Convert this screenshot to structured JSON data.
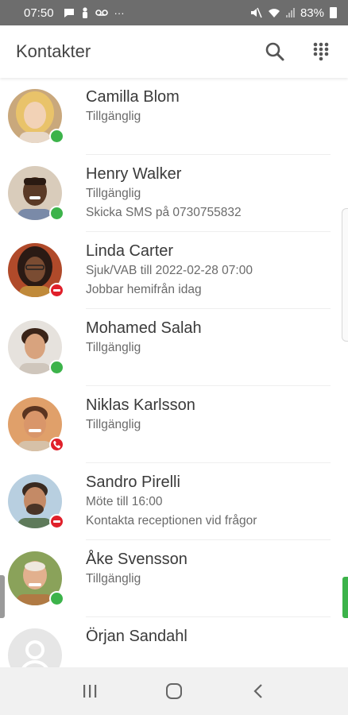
{
  "status_bar": {
    "time": "07:50",
    "battery": "83%",
    "icons": [
      "message-icon",
      "person-icon",
      "voicemail-icon",
      "more-icon",
      "mute-icon",
      "wifi-icon",
      "signal-icon",
      "battery-icon"
    ]
  },
  "app_bar": {
    "title": "Kontakter",
    "actions": [
      "search-icon",
      "dialpad-icon"
    ]
  },
  "colors": {
    "available": "#3cb34a",
    "busy": "#e0202a",
    "accent_green": "#3cb34a"
  },
  "contacts": [
    {
      "name": "Camilla Blom",
      "status": "Tillgänglig",
      "note": "",
      "presence": "available"
    },
    {
      "name": "Henry Walker",
      "status": "Tillgänglig",
      "note": "Skicka SMS på 0730755832",
      "presence": "available"
    },
    {
      "name": "Linda Carter",
      "status": "Sjuk/VAB till 2022-02-28 07:00",
      "note": "Jobbar hemifrån idag",
      "presence": "busy"
    },
    {
      "name": "Mohamed Salah",
      "status": "Tillgänglig",
      "note": "",
      "presence": "available"
    },
    {
      "name": "Niklas Karlsson",
      "status": "Tillgänglig",
      "note": "",
      "presence": "on-call"
    },
    {
      "name": "Sandro Pirelli",
      "status": "Möte till 16:00",
      "note": "Kontakta receptionen vid frågor",
      "presence": "busy"
    },
    {
      "name": "Åke Svensson",
      "status": "Tillgänglig",
      "note": "",
      "presence": "available"
    },
    {
      "name": "Örjan Sandahl",
      "status": "",
      "note": "",
      "presence": "none"
    }
  ],
  "nav_bar": {
    "buttons": [
      "recents-icon",
      "home-icon",
      "back-icon"
    ]
  }
}
